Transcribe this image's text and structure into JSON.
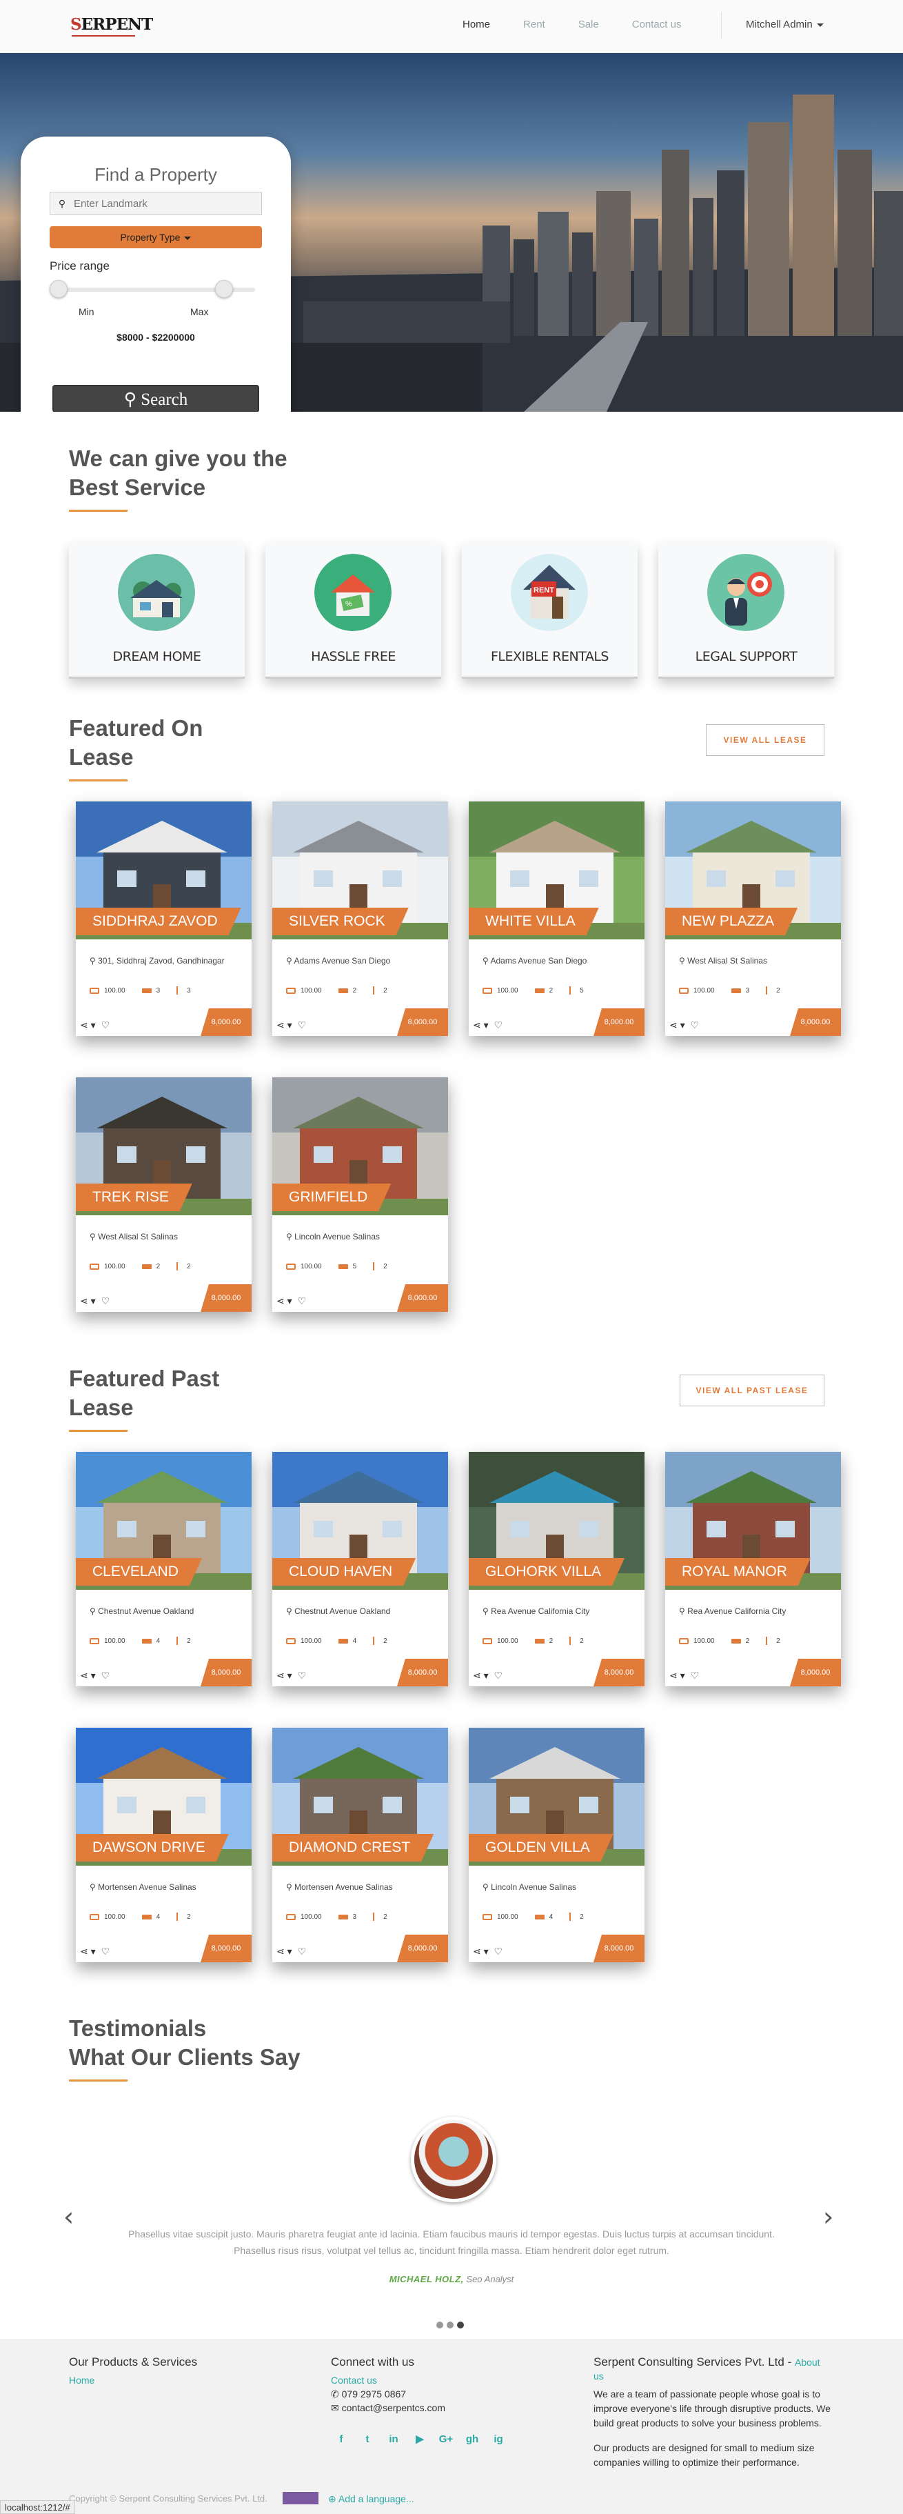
{
  "brand": {
    "name": "SERPENT"
  },
  "nav": {
    "links": [
      {
        "label": "Home"
      },
      {
        "label": "Rent"
      },
      {
        "label": "Sale"
      },
      {
        "label": "Contact us"
      }
    ],
    "user": "Mitchell Admin"
  },
  "search": {
    "title": "Find a Property",
    "landmark_placeholder": "Enter Landmark",
    "property_type": "Property Type",
    "price_label": "Price range",
    "min_label": "Min",
    "max_label": "Max",
    "price_range": "$8000 - $2200000",
    "button": "Search"
  },
  "services": {
    "title_line1": "We can give you the",
    "title_line2": "Best Service",
    "items": [
      {
        "label": "DREAM HOME",
        "icon": "house-icon"
      },
      {
        "label": "HASSLE FREE",
        "icon": "sold-tag-icon"
      },
      {
        "label": "FLEXIBLE RENTALS",
        "icon": "rent-sign-icon"
      },
      {
        "label": "LEGAL SUPPORT",
        "icon": "advisor-target-icon"
      }
    ]
  },
  "featured_lease": {
    "title_line1": "Featured On",
    "title_line2": "Lease",
    "view_all": "VIEW ALL LEASE",
    "properties": [
      {
        "name": "SIDDHRAJ ZAVOD",
        "location": "301, Siddhraj Zavod, Gandhinagar",
        "area": "100.00",
        "beds": "3",
        "baths": "3",
        "price": "8,000.00"
      },
      {
        "name": "SILVER ROCK",
        "location": "Adams Avenue San Diego",
        "area": "100.00",
        "beds": "2",
        "baths": "2",
        "price": "8,000.00"
      },
      {
        "name": "WHITE VILLA",
        "location": "Adams Avenue San Diego",
        "area": "100.00",
        "beds": "2",
        "baths": "5",
        "price": "8,000.00"
      },
      {
        "name": "NEW PLAZZA",
        "location": "West Alisal St Salinas",
        "area": "100.00",
        "beds": "3",
        "baths": "2",
        "price": "8,000.00"
      },
      {
        "name": "TREK RISE",
        "location": "West Alisal St Salinas",
        "area": "100.00",
        "beds": "2",
        "baths": "2",
        "price": "8,000.00"
      },
      {
        "name": "GRIMFIELD",
        "location": "Lincoln Avenue Salinas",
        "area": "100.00",
        "beds": "5",
        "baths": "2",
        "price": "8,000.00"
      }
    ]
  },
  "featured_past": {
    "title_line1": "Featured Past",
    "title_line2": "Lease",
    "view_all": "VIEW ALL PAST LEASE",
    "properties": [
      {
        "name": "CLEVELAND",
        "location": "Chestnut Avenue Oakland",
        "area": "100.00",
        "beds": "4",
        "baths": "2",
        "price": "8,000.00"
      },
      {
        "name": "CLOUD HAVEN",
        "location": "Chestnut Avenue Oakland",
        "area": "100.00",
        "beds": "4",
        "baths": "2",
        "price": "8,000.00"
      },
      {
        "name": "GLOHORK VILLA",
        "location": "Rea Avenue California City",
        "area": "100.00",
        "beds": "2",
        "baths": "2",
        "price": "8,000.00"
      },
      {
        "name": "ROYAL MANOR",
        "location": "Rea Avenue California City",
        "area": "100.00",
        "beds": "2",
        "baths": "2",
        "price": "8,000.00"
      },
      {
        "name": "DAWSON DRIVE",
        "location": "Mortensen Avenue Salinas",
        "area": "100.00",
        "beds": "4",
        "baths": "2",
        "price": "8,000.00"
      },
      {
        "name": "DIAMOND CREST",
        "location": "Mortensen Avenue Salinas",
        "area": "100.00",
        "beds": "3",
        "baths": "2",
        "price": "8,000.00"
      },
      {
        "name": "GOLDEN VILLA",
        "location": "Lincoln Avenue Salinas",
        "area": "100.00",
        "beds": "4",
        "baths": "2",
        "price": "8,000.00"
      }
    ]
  },
  "testimonials": {
    "title_line1": "Testimonials",
    "title_line2": "What Our Clients Say",
    "quote_line1": "Phasellus vitae suscipit justo. Mauris pharetra feugiat ante id lacinia. Etiam faucibus mauris id tempor egestas. Duis luctus turpis at accumsan tincidunt.",
    "quote_line2": "Phasellus risus risus, volutpat vel tellus ac, tincidunt fringilla massa. Etiam hendrerit dolor eget rutrum.",
    "author": "MICHAEL HOLZ,",
    "role": "Seo Analyst"
  },
  "footer": {
    "products_title": "Our Products & Services",
    "home_link": "Home",
    "connect_title": "Connect with us",
    "contact_link": "Contact us",
    "phone": "079 2975 0867",
    "email": "contact@serpentcs.com",
    "company_title": "Serpent Consulting Services Pvt. Ltd -",
    "about_link": "About",
    "about_link_2": "us",
    "about_line1": "We are a team of passionate people whose goal is to",
    "about_line2": "improve everyone's life through disruptive products. We",
    "about_line3": "build great products to solve your business problems.",
    "products_line1": "Our products are designed for small to medium size",
    "products_line2": "companies willing to optimize their performance.",
    "copyright": "Copyright © Serpent Consulting Services Pvt. Ltd.",
    "add_language": "Add a language...",
    "social": [
      "f",
      "t",
      "in",
      "▶",
      "G+",
      "gh",
      "ig"
    ]
  },
  "status_bar": "localhost:1212/#",
  "colors": {
    "accent": "#e07b39",
    "teal": "#2aa9a5",
    "heading": "#555555"
  }
}
